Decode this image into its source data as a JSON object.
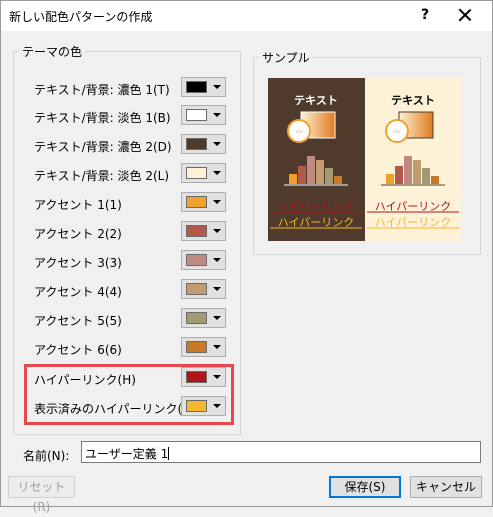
{
  "window": {
    "title": "新しい配色パターンの作成",
    "help_glyph": "?"
  },
  "theme_colors": {
    "group_label": "テーマの色",
    "rows": [
      {
        "label": "テキスト/背景: 濃色 1(T)",
        "color": "#000000"
      },
      {
        "label": "テキスト/背景: 淡色 1(B)",
        "color": "#ffffff"
      },
      {
        "label": "テキスト/背景: 濃色 2(D)",
        "color": "#4f3a2c"
      },
      {
        "label": "テキスト/背景: 淡色 2(L)",
        "color": "#fdf1d7"
      },
      {
        "label": "アクセント 1(1)",
        "color": "#f0a12a"
      },
      {
        "label": "アクセント 2(2)",
        "color": "#b25a4a"
      },
      {
        "label": "アクセント 3(3)",
        "color": "#c08a80"
      },
      {
        "label": "アクセント 4(4)",
        "color": "#c49a70"
      },
      {
        "label": "アクセント 5(5)",
        "color": "#a19a72"
      },
      {
        "label": "アクセント 6(6)",
        "color": "#c87a26"
      },
      {
        "label": "ハイパーリンク(H)",
        "color": "#b0151e"
      },
      {
        "label": "表示済みのハイパーリンク(F)",
        "color": "#f4b82a"
      }
    ]
  },
  "sample": {
    "group_label": "サンプル",
    "dark_text": "テキスト",
    "light_text": "テキスト",
    "hyperlink": "ハイパーリンク",
    "visited_hyperlink": "ハイパーリンク",
    "bar_colors": [
      "#f0a12a",
      "#b25a4a",
      "#c08a80",
      "#c49a70",
      "#a19a72",
      "#c87a26"
    ]
  },
  "name_field": {
    "label": "名前(N):",
    "value": "ユーザー定義 1"
  },
  "buttons": {
    "reset": "リセット(R)",
    "save": "保存(S)",
    "cancel": "キャンセル"
  }
}
